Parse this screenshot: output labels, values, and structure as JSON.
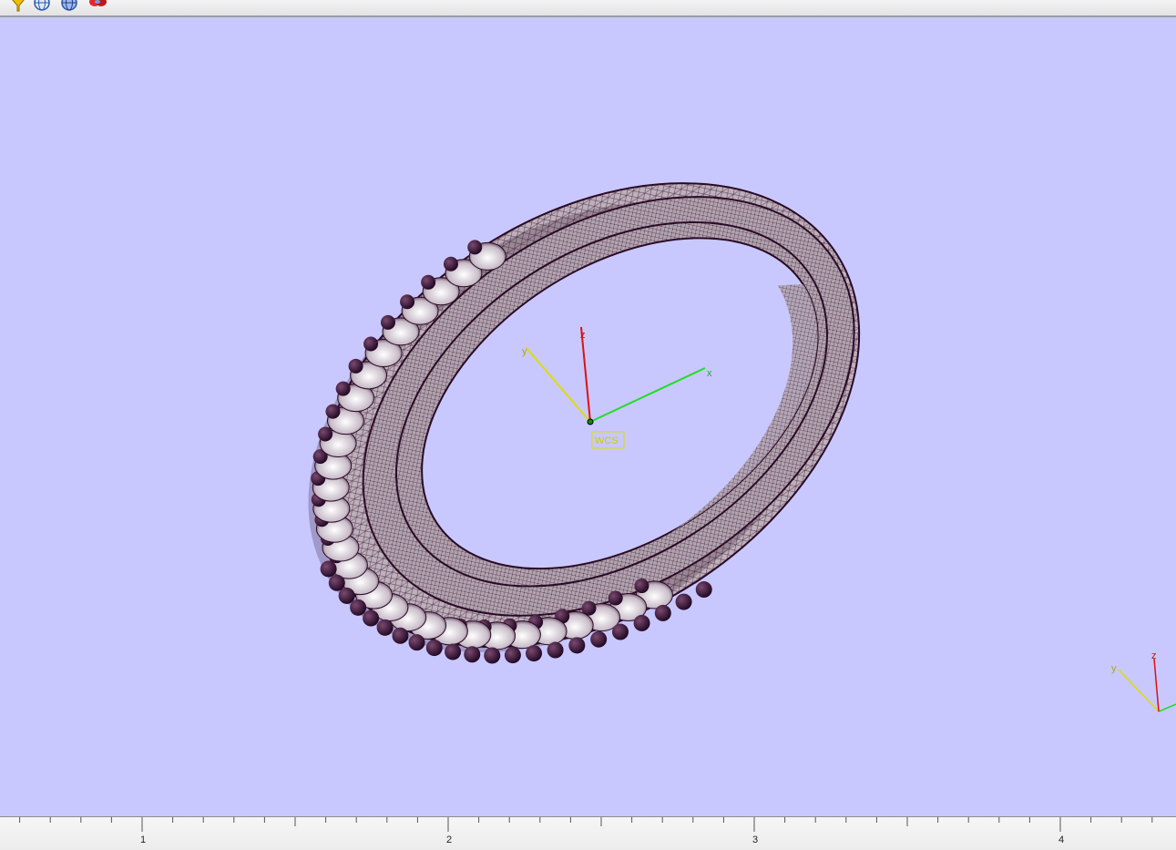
{
  "toolbar": {
    "buttons": [
      {
        "name": "funnel-filter-icon",
        "color": "#e8b400"
      },
      {
        "name": "globe-view-icon",
        "color": "#3a6fc4"
      },
      {
        "name": "globe-shaded-view-icon",
        "color": "#3a6fc4"
      },
      {
        "name": "render-view-icon",
        "color": "#d22020"
      }
    ]
  },
  "viewport": {
    "background": "#c8c8ff",
    "model": "ring-mesh",
    "mesh_color": "#3a1030",
    "world_axes": {
      "x_label": "x",
      "y_label": "y",
      "z_label": "z",
      "origin_label": "WCS",
      "x_color": "#22dd22",
      "y_color": "#dddd00",
      "z_color": "#dd1111"
    },
    "corner_axes": {
      "y_label": "y",
      "z_label": "z"
    }
  },
  "ruler": {
    "labels": [
      "1",
      "2",
      "3",
      "4"
    ]
  }
}
